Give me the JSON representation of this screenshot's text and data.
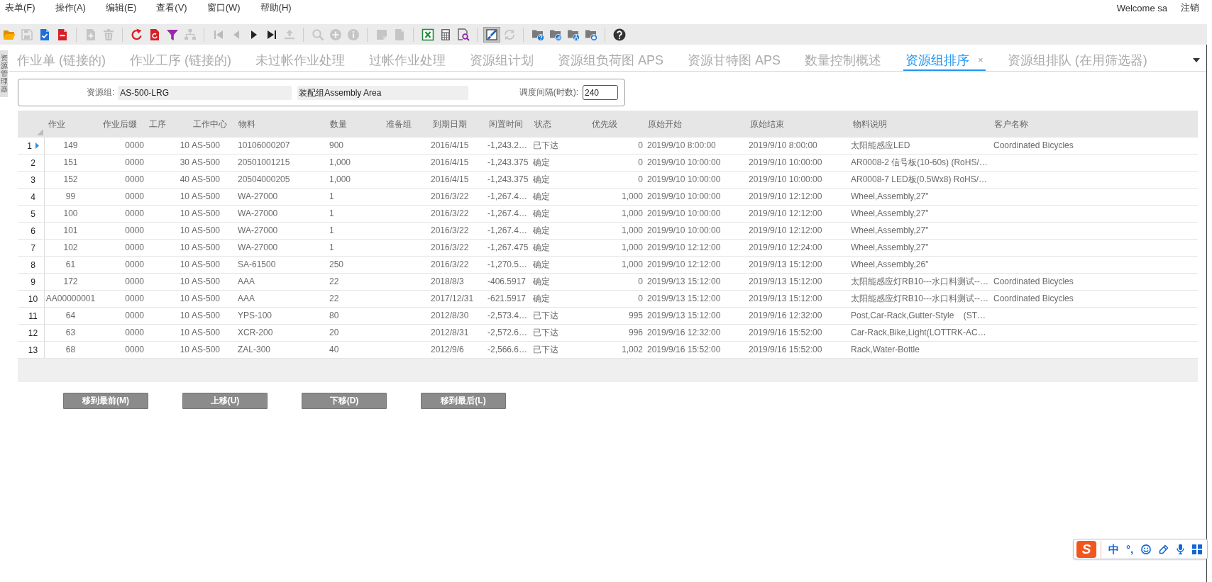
{
  "menu": {
    "items": [
      "表单(F)",
      "操作(A)",
      "编辑(E)",
      "查看(V)",
      "窗口(W)",
      "帮助(H)"
    ],
    "welcome": "Welcome sa",
    "logout": "注销"
  },
  "toolbar": {
    "groups": [
      [
        {
          "disabled": false,
          "pressed": false
        },
        {
          "disabled": true,
          "pressed": false
        },
        {
          "disabled": false,
          "pressed": false
        },
        {
          "disabled": false,
          "pressed": false
        }
      ],
      [
        {
          "disabled": true,
          "pressed": false
        },
        {
          "disabled": true,
          "pressed": false
        }
      ],
      [
        {
          "disabled": false,
          "pressed": false
        },
        {
          "disabled": false,
          "pressed": false
        },
        {
          "disabled": false,
          "pressed": false
        },
        {
          "disabled": true,
          "pressed": false
        }
      ],
      [
        {
          "disabled": true,
          "pressed": false
        },
        {
          "disabled": true,
          "pressed": false
        },
        {
          "disabled": false,
          "pressed": false
        },
        {
          "disabled": false,
          "pressed": false
        },
        {
          "disabled": true,
          "pressed": false
        }
      ],
      [
        {
          "disabled": true,
          "pressed": false
        },
        {
          "disabled": true,
          "pressed": false
        },
        {
          "disabled": true,
          "pressed": false
        }
      ],
      [
        {
          "disabled": true,
          "pressed": false
        },
        {
          "disabled": true,
          "pressed": false
        }
      ],
      [
        {
          "disabled": false,
          "pressed": false
        },
        {
          "disabled": false,
          "pressed": false
        },
        {
          "disabled": false,
          "pressed": false
        }
      ],
      [
        {
          "disabled": false,
          "pressed": true
        },
        {
          "disabled": true,
          "pressed": false
        }
      ],
      [
        {
          "disabled": false,
          "pressed": false
        },
        {
          "disabled": false,
          "pressed": false
        },
        {
          "disabled": false,
          "pressed": false
        },
        {
          "disabled": false,
          "pressed": false
        }
      ],
      [
        {
          "disabled": false,
          "pressed": false
        }
      ]
    ]
  },
  "side_panel": {
    "label": "资源管理器"
  },
  "tabs": [
    {
      "label": "作业单 (链接的)",
      "selected": false
    },
    {
      "label": "作业工序 (链接的)",
      "selected": false
    },
    {
      "label": "未过帐作业处理",
      "selected": false
    },
    {
      "label": "过帐作业处理",
      "selected": false
    },
    {
      "label": "资源组计划",
      "selected": false
    },
    {
      "label": "资源组负荷图 APS",
      "selected": false
    },
    {
      "label": "资源甘特图 APS",
      "selected": false
    },
    {
      "label": "数量控制概述",
      "selected": false
    },
    {
      "label": "资源组排序",
      "selected": true,
      "close": "×"
    },
    {
      "label": "资源组排队 (在用筛选器)",
      "selected": false
    }
  ],
  "filter": {
    "resource_group_label": "资源组:",
    "resource_group": "AS-500-LRG",
    "description": "装配组Assembly Area",
    "interval_label": "调度间隔(时数):",
    "interval": "240"
  },
  "table": {
    "columns": [
      "作业",
      "作业后缀",
      "工序",
      "工作中心",
      "物料",
      "数量",
      "准备组",
      "到期日期",
      "闲置时间",
      "状态",
      "优先级",
      "原始开始",
      "原始结束",
      "物料说明",
      "客户名称"
    ],
    "rows": [
      {
        "number": "1",
        "selected": true,
        "job": "149",
        "suffix": "0000",
        "operation": "10",
        "work_center": "AS-500",
        "item": "10106000207",
        "quantity": "900",
        "due_date": "2016/4/15",
        "idle_time": "-1,243.2…",
        "status": "已下达",
        "priority": "0",
        "start": "2019/9/10 8:00:00",
        "end": "2019/9/10 8:00:00",
        "description": "太阳能感应LED",
        "customer": "Coordinated Bicycles"
      },
      {
        "number": "2",
        "selected": false,
        "job": "151",
        "suffix": "0000",
        "operation": "30",
        "work_center": "AS-500",
        "item": "20501001215",
        "quantity": "1,000",
        "due_date": "2016/4/15",
        "idle_time": "-1,243.375",
        "status": "确定",
        "priority": "0",
        "start": "2019/9/10 10:00:00",
        "end": "2019/9/10 10:00:00",
        "description": "AR0008-2 信号板(10-60s) (RoHS/…"
      },
      {
        "number": "3",
        "selected": false,
        "job": "152",
        "suffix": "0000",
        "operation": "40",
        "work_center": "AS-500",
        "item": "20504000205",
        "quantity": "1,000",
        "due_date": "2016/4/15",
        "idle_time": "-1,243.375",
        "status": "确定",
        "priority": "0",
        "start": "2019/9/10 10:00:00",
        "end": "2019/9/10 10:00:00",
        "description": "AR0008-7 LED板(0.5Wx8) RoHS/…"
      },
      {
        "number": "4",
        "selected": false,
        "job": "99",
        "suffix": "0000",
        "operation": "10",
        "work_center": "AS-500",
        "item": "WA-27000",
        "quantity": "1",
        "due_date": "2016/3/22",
        "idle_time": "-1,267.4…",
        "status": "确定",
        "priority": "1,000",
        "start": "2019/9/10 10:00:00",
        "end": "2019/9/10 12:12:00",
        "description": "Wheel,Assembly,27\""
      },
      {
        "number": "5",
        "selected": false,
        "job": "100",
        "suffix": "0000",
        "operation": "10",
        "work_center": "AS-500",
        "item": "WA-27000",
        "quantity": "1",
        "due_date": "2016/3/22",
        "idle_time": "-1,267.4…",
        "status": "确定",
        "priority": "1,000",
        "start": "2019/9/10 10:00:00",
        "end": "2019/9/10 12:12:00",
        "description": "Wheel,Assembly,27\""
      },
      {
        "number": "6",
        "selected": false,
        "job": "101",
        "suffix": "0000",
        "operation": "10",
        "work_center": "AS-500",
        "item": "WA-27000",
        "quantity": "1",
        "due_date": "2016/3/22",
        "idle_time": "-1,267.4…",
        "status": "确定",
        "priority": "1,000",
        "start": "2019/9/10 10:00:00",
        "end": "2019/9/10 12:12:00",
        "description": "Wheel,Assembly,27\""
      },
      {
        "number": "7",
        "selected": false,
        "job": "102",
        "suffix": "0000",
        "operation": "10",
        "work_center": "AS-500",
        "item": "WA-27000",
        "quantity": "1",
        "due_date": "2016/3/22",
        "idle_time": "-1,267.475",
        "status": "确定",
        "priority": "1,000",
        "start": "2019/9/10 12:12:00",
        "end": "2019/9/10 12:24:00",
        "description": "Wheel,Assembly,27\""
      },
      {
        "number": "8",
        "selected": false,
        "job": "61",
        "suffix": "0000",
        "operation": "10",
        "work_center": "AS-500",
        "item": "SA-61500",
        "quantity": "250",
        "due_date": "2016/3/22",
        "idle_time": "-1,270.5…",
        "status": "确定",
        "priority": "1,000",
        "start": "2019/9/10 12:12:00",
        "end": "2019/9/13 15:12:00",
        "description": "Wheel,Assembly,26\""
      },
      {
        "number": "9",
        "selected": false,
        "job": "172",
        "suffix": "0000",
        "operation": "10",
        "work_center": "AS-500",
        "item": "AAA",
        "quantity": "22",
        "due_date": "2018/8/3",
        "idle_time": "-406.5917",
        "status": "确定",
        "priority": "0",
        "start": "2019/9/13 15:12:00",
        "end": "2019/9/13 15:12:00",
        "description": "太阳能感应灯RB10---水口料测试--…",
        "customer": "Coordinated Bicycles"
      },
      {
        "number": "10",
        "selected": false,
        "job": "AA00000001",
        "suffix": "0000",
        "operation": "10",
        "work_center": "AS-500",
        "item": "AAA",
        "quantity": "22",
        "due_date": "2017/12/31",
        "idle_time": "-621.5917",
        "status": "确定",
        "priority": "0",
        "start": "2019/9/13 15:12:00",
        "end": "2019/9/13 15:12:00",
        "description": "太阳能感应灯RB10---水口料测试--…",
        "customer": "Coordinated Bicycles"
      },
      {
        "number": "11",
        "selected": false,
        "job": "64",
        "suffix": "0000",
        "operation": "10",
        "work_center": "AS-500",
        "item": "YPS-100",
        "quantity": "80",
        "due_date": "2012/8/30",
        "idle_time": "-2,573.4…",
        "status": "已下达",
        "priority": "995",
        "start": "2019/9/13 15:12:00",
        "end": "2019/9/16 12:32:00",
        "description": "Post,Car-Rack,Gutter-Style    (ST…"
      },
      {
        "number": "12",
        "selected": false,
        "job": "63",
        "suffix": "0000",
        "operation": "10",
        "work_center": "AS-500",
        "item": "XCR-200",
        "quantity": "20",
        "due_date": "2012/8/31",
        "idle_time": "-2,572.6…",
        "status": "已下达",
        "priority": "996",
        "start": "2019/9/16 12:32:00",
        "end": "2019/9/16 15:52:00",
        "description": "Car-Rack,Bike,Light(LOTTRK-AC…"
      },
      {
        "number": "13",
        "selected": false,
        "job": "68",
        "suffix": "0000",
        "operation": "10",
        "work_center": "AS-500",
        "item": "ZAL-300",
        "quantity": "40",
        "due_date": "2012/9/6",
        "idle_time": "-2,566.6…",
        "status": "已下达",
        "priority": "1,002",
        "start": "2019/9/16 15:52:00",
        "end": "2019/9/16 15:52:00",
        "description": "Rack,Water-Bottle"
      }
    ]
  },
  "actions": [
    "移到最前(M)",
    "上移(U)",
    "下移(D)",
    "移到最后(L)"
  ],
  "ime_bar": {
    "logo": "S",
    "mode": "中",
    "punctuation": "°,"
  }
}
